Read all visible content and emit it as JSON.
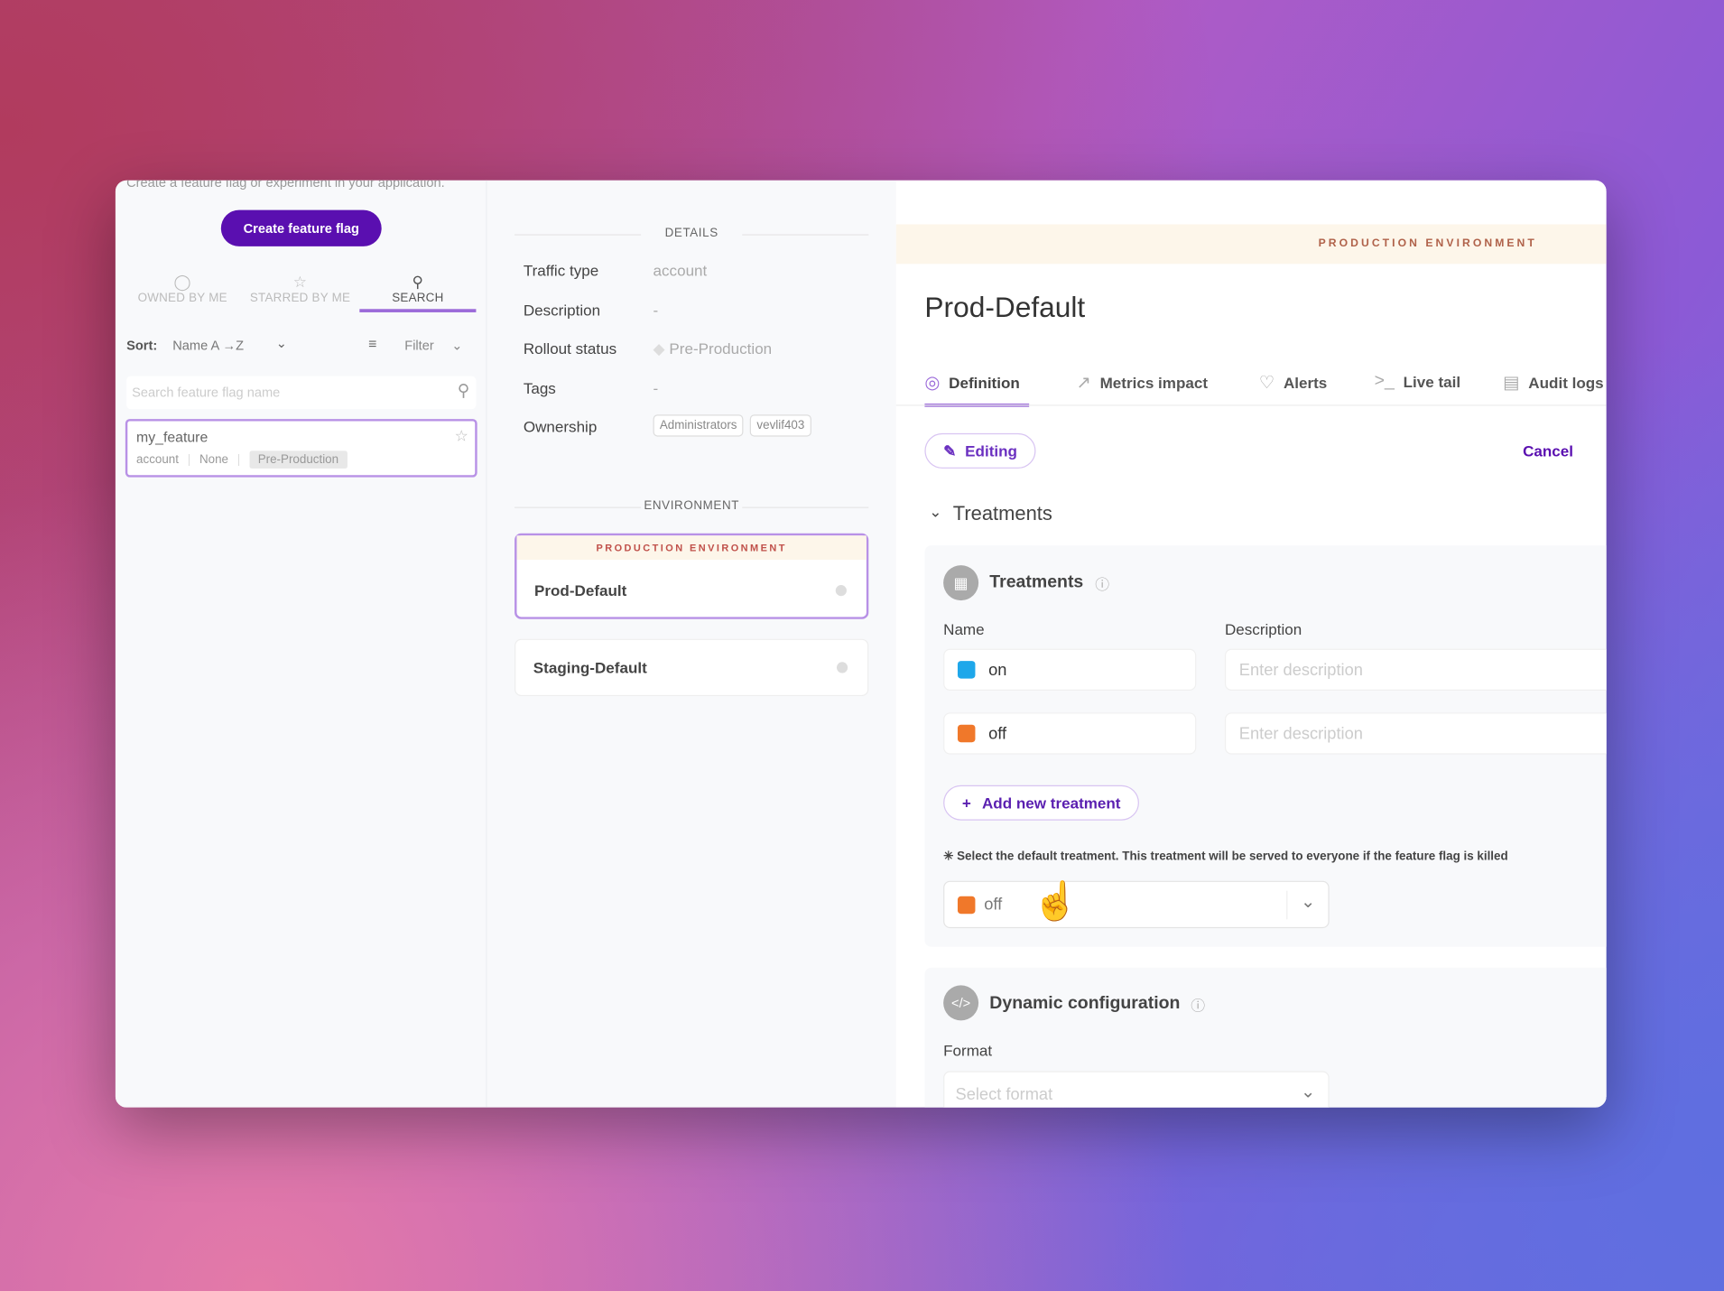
{
  "left": {
    "subtitle": "Create a feature flag or experiment in your application.",
    "create_button": "Create feature flag",
    "tabs": [
      {
        "label": "OWNED BY ME",
        "icon": "user-icon"
      },
      {
        "label": "STARRED BY ME",
        "icon": "star-icon"
      },
      {
        "label": "SEARCH",
        "icon": "search-icon"
      }
    ],
    "sort_label": "Sort:",
    "sort_value": "Name A →Z",
    "filter_label": "Filter",
    "search_placeholder": "Search feature flag name",
    "flags": [
      {
        "name": "my_feature",
        "traffic_type": "account",
        "owner": "None",
        "status": "Pre-Production"
      }
    ]
  },
  "details": {
    "heading": "DETAILS",
    "rows": [
      {
        "label": "Traffic type",
        "value": "account"
      },
      {
        "label": "Description",
        "value": "-"
      },
      {
        "label": "Rollout status",
        "value": "Pre-Production"
      },
      {
        "label": "Tags",
        "value": "-"
      },
      {
        "label": "Ownership",
        "chips": [
          "Administrators",
          "vevlif403"
        ]
      }
    ]
  },
  "environment": {
    "heading": "ENVIRONMENT",
    "production_label": "PRODUCTION ENVIRONMENT",
    "items": [
      "Prod-Default",
      "Staging-Default"
    ]
  },
  "right": {
    "banner": "PRODUCTION ENVIRONMENT",
    "title": "Prod-Default",
    "tabs": [
      {
        "label": "Definition",
        "icon": "target-icon",
        "active": true
      },
      {
        "label": "Metrics impact",
        "icon": "chart-icon"
      },
      {
        "label": "Alerts",
        "icon": "bell-icon"
      },
      {
        "label": "Live tail",
        "icon": "terminal-icon"
      },
      {
        "label": "Audit logs",
        "icon": "document-icon"
      }
    ],
    "editing": "Editing",
    "cancel": "Cancel",
    "section": "Treatments",
    "treatments": {
      "title": "Treatments",
      "name_col": "Name",
      "desc_col": "Description",
      "desc_placeholder": "Enter description",
      "items": [
        {
          "name": "on",
          "color": "#1ea7ea"
        },
        {
          "name": "off",
          "color": "#f0782a"
        }
      ],
      "add_button": "Add new treatment",
      "default_note": "Select the default treatment. This treatment will be served to everyone if the feature flag is killed",
      "default_value": "off",
      "default_color": "#f0782a"
    },
    "dynamic": {
      "title": "Dynamic configuration",
      "format_label": "Format",
      "format_placeholder": "Select format"
    }
  },
  "colors": {
    "primary": "#5a0fb0",
    "accent": "#9b6ad9",
    "banner_bg": "#fdf6ea",
    "banner_text": "#b0624a"
  }
}
